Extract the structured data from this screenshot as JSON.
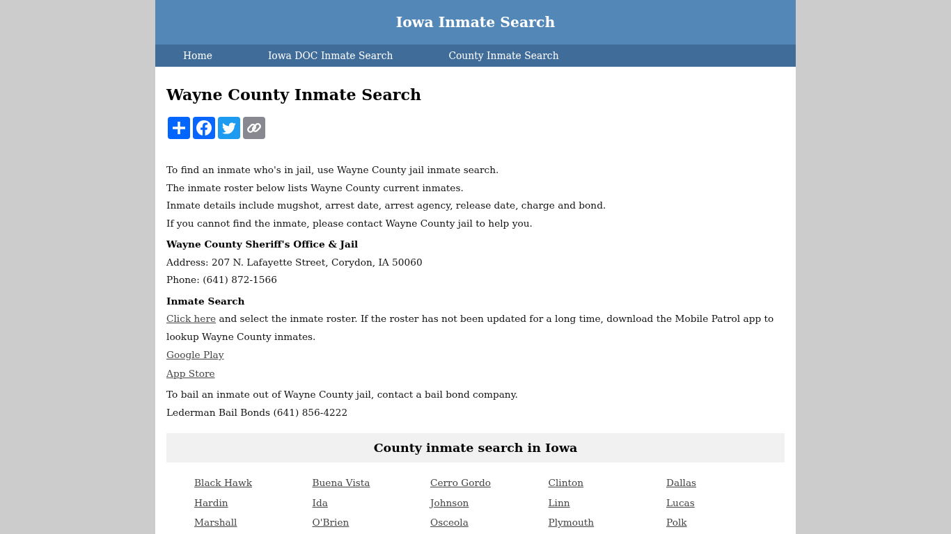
{
  "header": {
    "title": "Iowa Inmate Search"
  },
  "nav": {
    "items": [
      "Home",
      "Iowa DOC Inmate Search",
      "County Inmate Search"
    ]
  },
  "article": {
    "title": "Wayne County Inmate Search",
    "share_buttons": [
      {
        "kind": "share"
      },
      {
        "kind": "facebook"
      },
      {
        "kind": "twitter"
      },
      {
        "kind": "copy_link"
      }
    ],
    "intro": [
      "To find an inmate who's in jail, use Wayne County jail inmate search.",
      "The inmate roster below lists Wayne County current inmates.",
      "Inmate details include mugshot, arrest date, arrest agency, release date, charge and bond.",
      "If you cannot find the inmate, please contact Wayne County jail to help you."
    ],
    "sheriff": {
      "heading": "Wayne County Sheriff's Office & Jail",
      "address": "Address: 207 N. Lafayette Street, Corydon, IA 50060",
      "phone": "Phone: (641) 872-1566"
    },
    "inmate_search": {
      "heading": "Inmate Search",
      "link": "Click here",
      "text": "and select the inmate roster. If the roster has not been updated for a long time, download the Mobile Patrol app to lookup Wayne County inmates.",
      "app_links": [
        "Google Play",
        "App Store"
      ]
    },
    "bail": [
      "To bail an inmate out of Wayne County jail, contact a bail bond company.",
      "Lederman Bail Bonds (641) 856-4222"
    ]
  },
  "county_section": {
    "title": "County inmate search in Iowa",
    "counties": [
      "Black Hawk",
      "Buena Vista",
      "Cerro Gordo",
      "Clinton",
      "Dallas",
      "Hardin",
      "Ida",
      "Johnson",
      "Linn",
      "Lucas",
      "Marshall",
      "O'Brien",
      "Osceola",
      "Plymouth",
      "Polk"
    ]
  }
}
